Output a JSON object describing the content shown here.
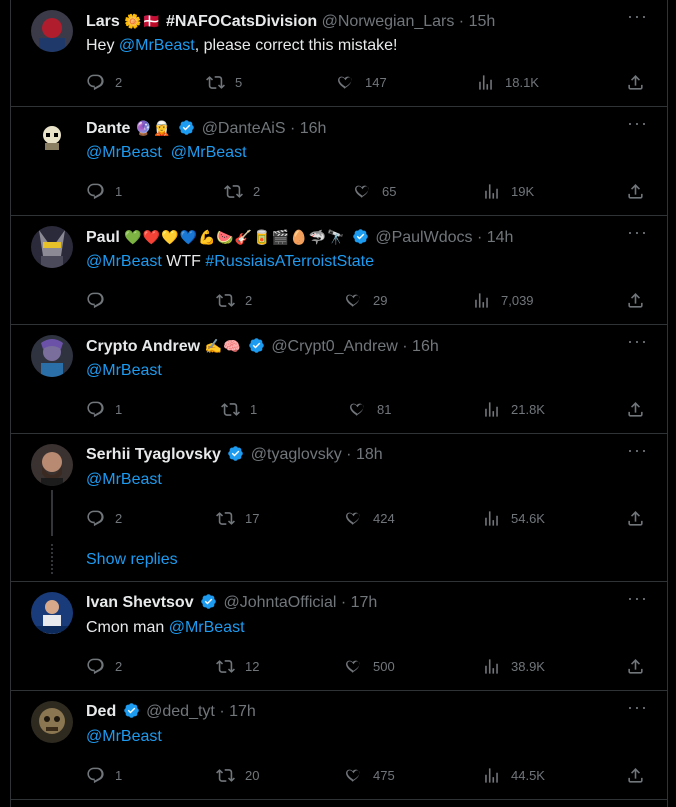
{
  "tweets": [
    {
      "name": "Lars",
      "emoji": "🌼🇩🇰 ",
      "extra": "#NAFOCatsDivision",
      "handle": "@Norwegian_Lars · 15h",
      "text_pre": "Hey ",
      "mention1": "@MrBeast",
      "text_mid": ", please correct this mistake!",
      "mention2": "",
      "text_post": "",
      "reply": "2",
      "retweet": "5",
      "like": "147",
      "views": "18.1K",
      "verified": false
    },
    {
      "name": "Dante",
      "emoji": "🔮🧝",
      "extra": "",
      "handle": "@DanteAiS · 16h",
      "text_pre": "",
      "mention1": "@MrBeast",
      "text_mid": "  ",
      "mention2": "@MrBeast",
      "text_post": "",
      "reply": "1",
      "retweet": "2",
      "like": "65",
      "views": "19K",
      "verified": true
    },
    {
      "name": "Paul",
      "emoji": "💚❤️💛💙💪🍉🎸🥫🎬🥚🦈🔭",
      "extra": "",
      "handle": "@PaulWdocs · 14h",
      "text_pre": "",
      "mention1": "@MrBeast",
      "text_mid": " WTF ",
      "mention2": "#RussiaisATerroistState",
      "text_post": "",
      "reply": "",
      "retweet": "2",
      "like": "29",
      "views": "7,039",
      "verified": true
    },
    {
      "name": "Crypto Andrew",
      "emoji": "✍️🧠",
      "extra": "",
      "handle": "@Crypt0_Andrew · 16h",
      "text_pre": "",
      "mention1": "@MrBeast",
      "text_mid": "",
      "mention2": "",
      "text_post": "",
      "reply": "1",
      "retweet": "1",
      "like": "81",
      "views": "21.8K",
      "verified": true
    },
    {
      "name": "Serhii Tyaglovsky",
      "emoji": "",
      "extra": "",
      "handle": "@tyaglovsky · 18h",
      "text_pre": "",
      "mention1": "@MrBeast",
      "text_mid": "",
      "mention2": "",
      "text_post": "",
      "reply": "2",
      "retweet": "17",
      "like": "424",
      "views": "54.6K",
      "verified": true,
      "show_replies": "Show replies"
    },
    {
      "name": "Ivan Shevtsov",
      "emoji": "",
      "extra": "",
      "handle": "@JohntaOfficial · 17h",
      "text_pre": "Cmon man ",
      "mention1": "@MrBeast",
      "text_mid": "",
      "mention2": "",
      "text_post": "",
      "reply": "2",
      "retweet": "12",
      "like": "500",
      "views": "38.9K",
      "verified": true
    },
    {
      "name": "Ded",
      "emoji": "",
      "extra": "",
      "handle": "@ded_tyt · 17h",
      "text_pre": "",
      "mention1": "@MrBeast",
      "text_mid": "",
      "mention2": "",
      "text_post": "",
      "reply": "1",
      "retweet": "20",
      "like": "475",
      "views": "44.5K",
      "verified": true
    }
  ],
  "colors": {
    "accent": "#1d9bf0",
    "muted": "#71767b",
    "text": "#e7e9ea",
    "border": "#2f3336"
  }
}
